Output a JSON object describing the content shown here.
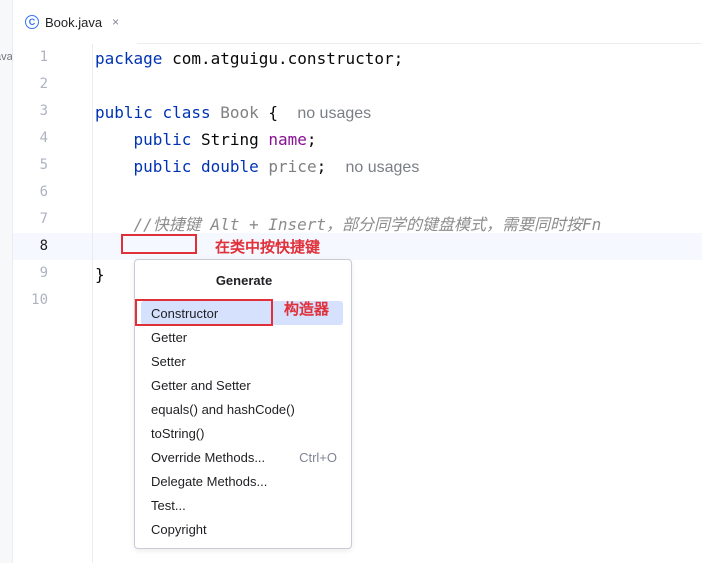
{
  "left_strip": {
    "text": "ava"
  },
  "tab": {
    "icon": "class-icon",
    "icon_glyph": "C",
    "title": "Book.java",
    "close_glyph": "×"
  },
  "line_numbers": [
    "1",
    "2",
    "3",
    "4",
    "5",
    "6",
    "7",
    "8",
    "9",
    "10"
  ],
  "current_line": "8",
  "code": {
    "line1": {
      "kw": "package",
      "rest": " com.atguigu.constructor;"
    },
    "line3": {
      "kw1": "public",
      "kw2": "class",
      "name": "Book",
      "brace": " {",
      "hint": "no usages"
    },
    "line4": {
      "kw": "public",
      "type": " String ",
      "field": "name",
      "semi": ";"
    },
    "line5": {
      "kw1": "public",
      "kw2": "double",
      "field": "price",
      "semi": ";",
      "hint": "no usages"
    },
    "line7": {
      "comment": "//快捷键 Alt + Insert，部分同学的键盘模式，需要同时按Fn"
    },
    "line9": {
      "brace": "}"
    }
  },
  "annotations": {
    "shortcut_label": "在类中按快捷键",
    "constructor_label": "构造器",
    "highlight_color": "#e0303a"
  },
  "popup": {
    "title": "Generate",
    "items": [
      {
        "label": "Constructor",
        "selected": true
      },
      {
        "label": "Getter"
      },
      {
        "label": "Setter"
      },
      {
        "label": "Getter and Setter"
      },
      {
        "label": "equals() and hashCode()"
      },
      {
        "label": "toString()"
      },
      {
        "label": "Override Methods...",
        "shortcut": "Ctrl+O"
      },
      {
        "label": "Delegate Methods..."
      },
      {
        "label": "Test..."
      },
      {
        "label": "Copyright"
      }
    ]
  },
  "colors": {
    "keyword": "#0033b3",
    "field": "#871094",
    "comment": "#8c8c8c",
    "selection": "#d5e1fd",
    "caret_row": "#f5f8fe"
  }
}
